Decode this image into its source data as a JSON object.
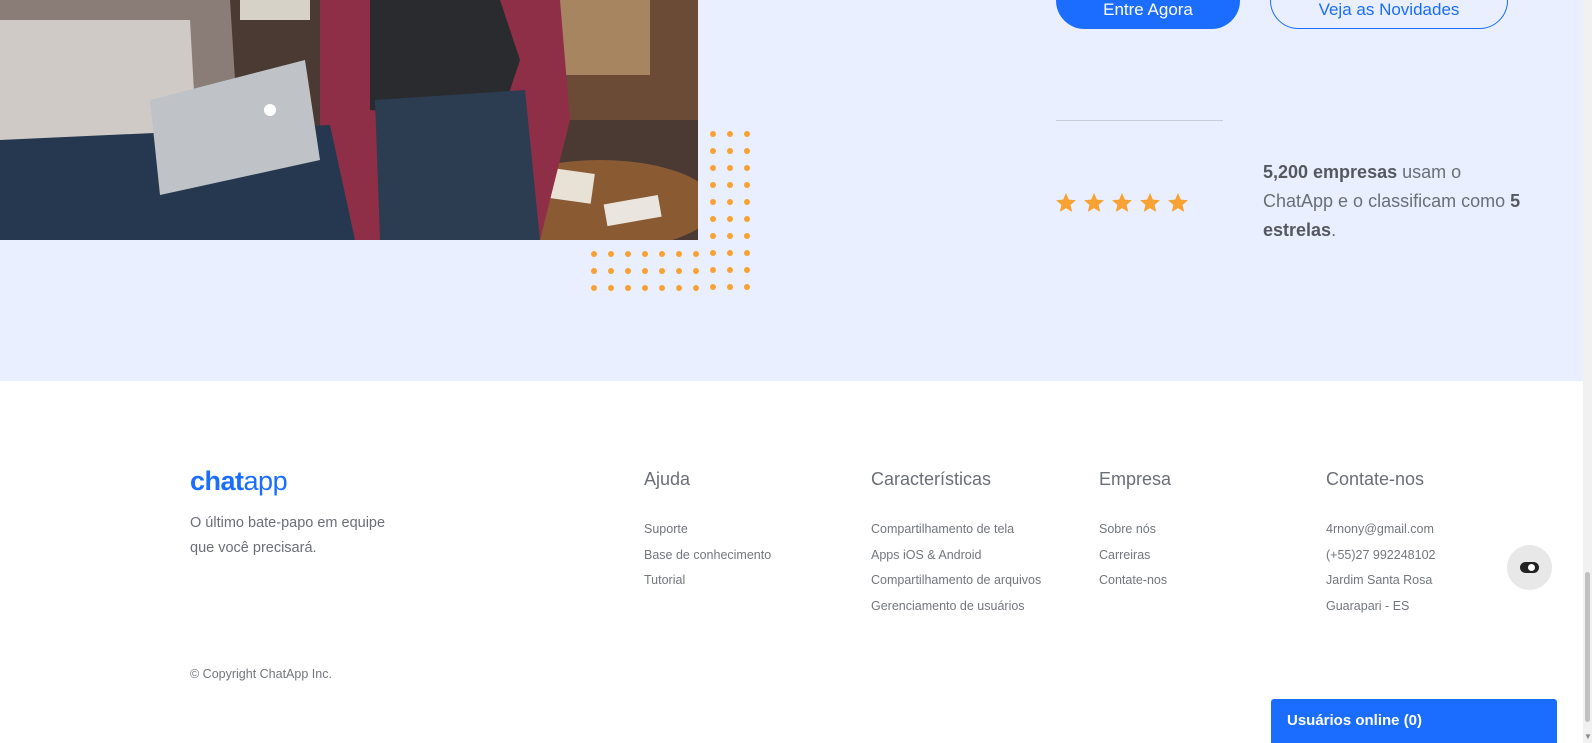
{
  "hero": {
    "buttons": {
      "primary_label": "Entre Agora",
      "secondary_label": "Veja as Novidades"
    },
    "rating": {
      "stars": 5,
      "text_bold_1": "5,200 empresas",
      "text_plain_1": " usam o ChatApp e o classificam como ",
      "text_bold_2": "5 estrelas",
      "text_plain_2": "."
    }
  },
  "footer": {
    "logo": {
      "bold": "chat",
      "light": "app"
    },
    "tagline": "O último bate-papo em equipe que você precisará.",
    "columns": [
      {
        "title": "Ajuda",
        "items": [
          "Suporte",
          "Base de conhecimento",
          "Tutorial"
        ]
      },
      {
        "title": "Características",
        "items": [
          "Compartilhamento de tela",
          "Apps iOS & Android",
          "Compartilhamento de arquivos",
          "Gerenciamento de usuários"
        ]
      },
      {
        "title": "Empresa",
        "items": [
          "Sobre nós",
          "Carreiras",
          "Contate-nos"
        ]
      },
      {
        "title": "Contate-nos",
        "items": [
          "4rnony@gmail.com",
          "(+55)27 992248102",
          "Jardim Santa Rosa",
          "Guarapari - ES"
        ]
      }
    ],
    "copyright": "© Copyright ChatApp Inc."
  },
  "widgets": {
    "online_users": "Usuários online (0)",
    "theme_toggle_icon": "toggle-icon"
  },
  "colors": {
    "accent": "#1a6dff",
    "hero_bg": "#e9efff",
    "star": "#f7a233",
    "dots": "#f7a233"
  }
}
